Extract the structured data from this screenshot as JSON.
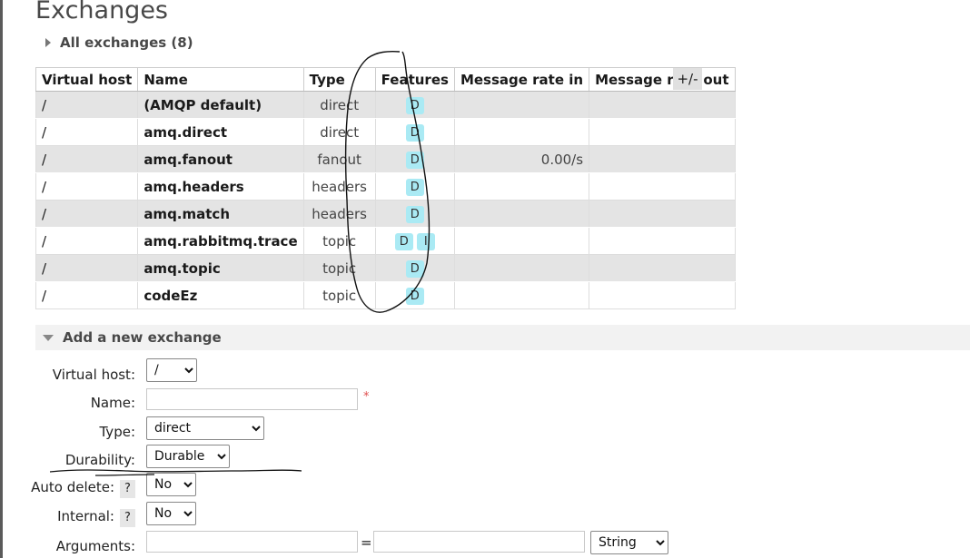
{
  "page": {
    "title": "Exchanges",
    "all_exchanges_label": "All exchanges (8)",
    "plus_minus_label": "+/-"
  },
  "table": {
    "columns": [
      "Virtual host",
      "Name",
      "Type",
      "Features",
      "Message rate in",
      "Message rate out"
    ],
    "rows": [
      {
        "vhost": "/",
        "name": "(AMQP default)",
        "type": "direct",
        "features": [
          "D"
        ],
        "rate_in": "",
        "rate_out": ""
      },
      {
        "vhost": "/",
        "name": "amq.direct",
        "type": "direct",
        "features": [
          "D"
        ],
        "rate_in": "",
        "rate_out": ""
      },
      {
        "vhost": "/",
        "name": "amq.fanout",
        "type": "fanout",
        "features": [
          "D"
        ],
        "rate_in": "0.00/s",
        "rate_out": ""
      },
      {
        "vhost": "/",
        "name": "amq.headers",
        "type": "headers",
        "features": [
          "D"
        ],
        "rate_in": "",
        "rate_out": ""
      },
      {
        "vhost": "/",
        "name": "amq.match",
        "type": "headers",
        "features": [
          "D"
        ],
        "rate_in": "",
        "rate_out": ""
      },
      {
        "vhost": "/",
        "name": "amq.rabbitmq.trace",
        "type": "topic",
        "features": [
          "D",
          "I"
        ],
        "rate_in": "",
        "rate_out": ""
      },
      {
        "vhost": "/",
        "name": "amq.topic",
        "type": "topic",
        "features": [
          "D"
        ],
        "rate_in": "",
        "rate_out": ""
      },
      {
        "vhost": "/",
        "name": "codeEz",
        "type": "topic",
        "features": [
          "D"
        ],
        "rate_in": "",
        "rate_out": ""
      }
    ]
  },
  "add_section": {
    "title": "Add a new exchange"
  },
  "form": {
    "virtual_host_label": "Virtual host:",
    "virtual_host_value": "/",
    "name_label": "Name:",
    "name_value": "",
    "required_mark": "*",
    "type_label": "Type:",
    "type_value": "direct",
    "durability_label": "Durability:",
    "durability_value": "Durable",
    "auto_delete_label": "Auto delete:",
    "auto_delete_value": "No",
    "internal_label": "Internal:",
    "internal_value": "No",
    "arguments_label": "Arguments:",
    "arguments_eq": "=",
    "arguments_type_value": "String",
    "help_label": "?"
  },
  "colors": {
    "feature_badge": "#aaeaf4",
    "row_alt": "#e4e4e4",
    "annotation_ink": "#111111"
  }
}
